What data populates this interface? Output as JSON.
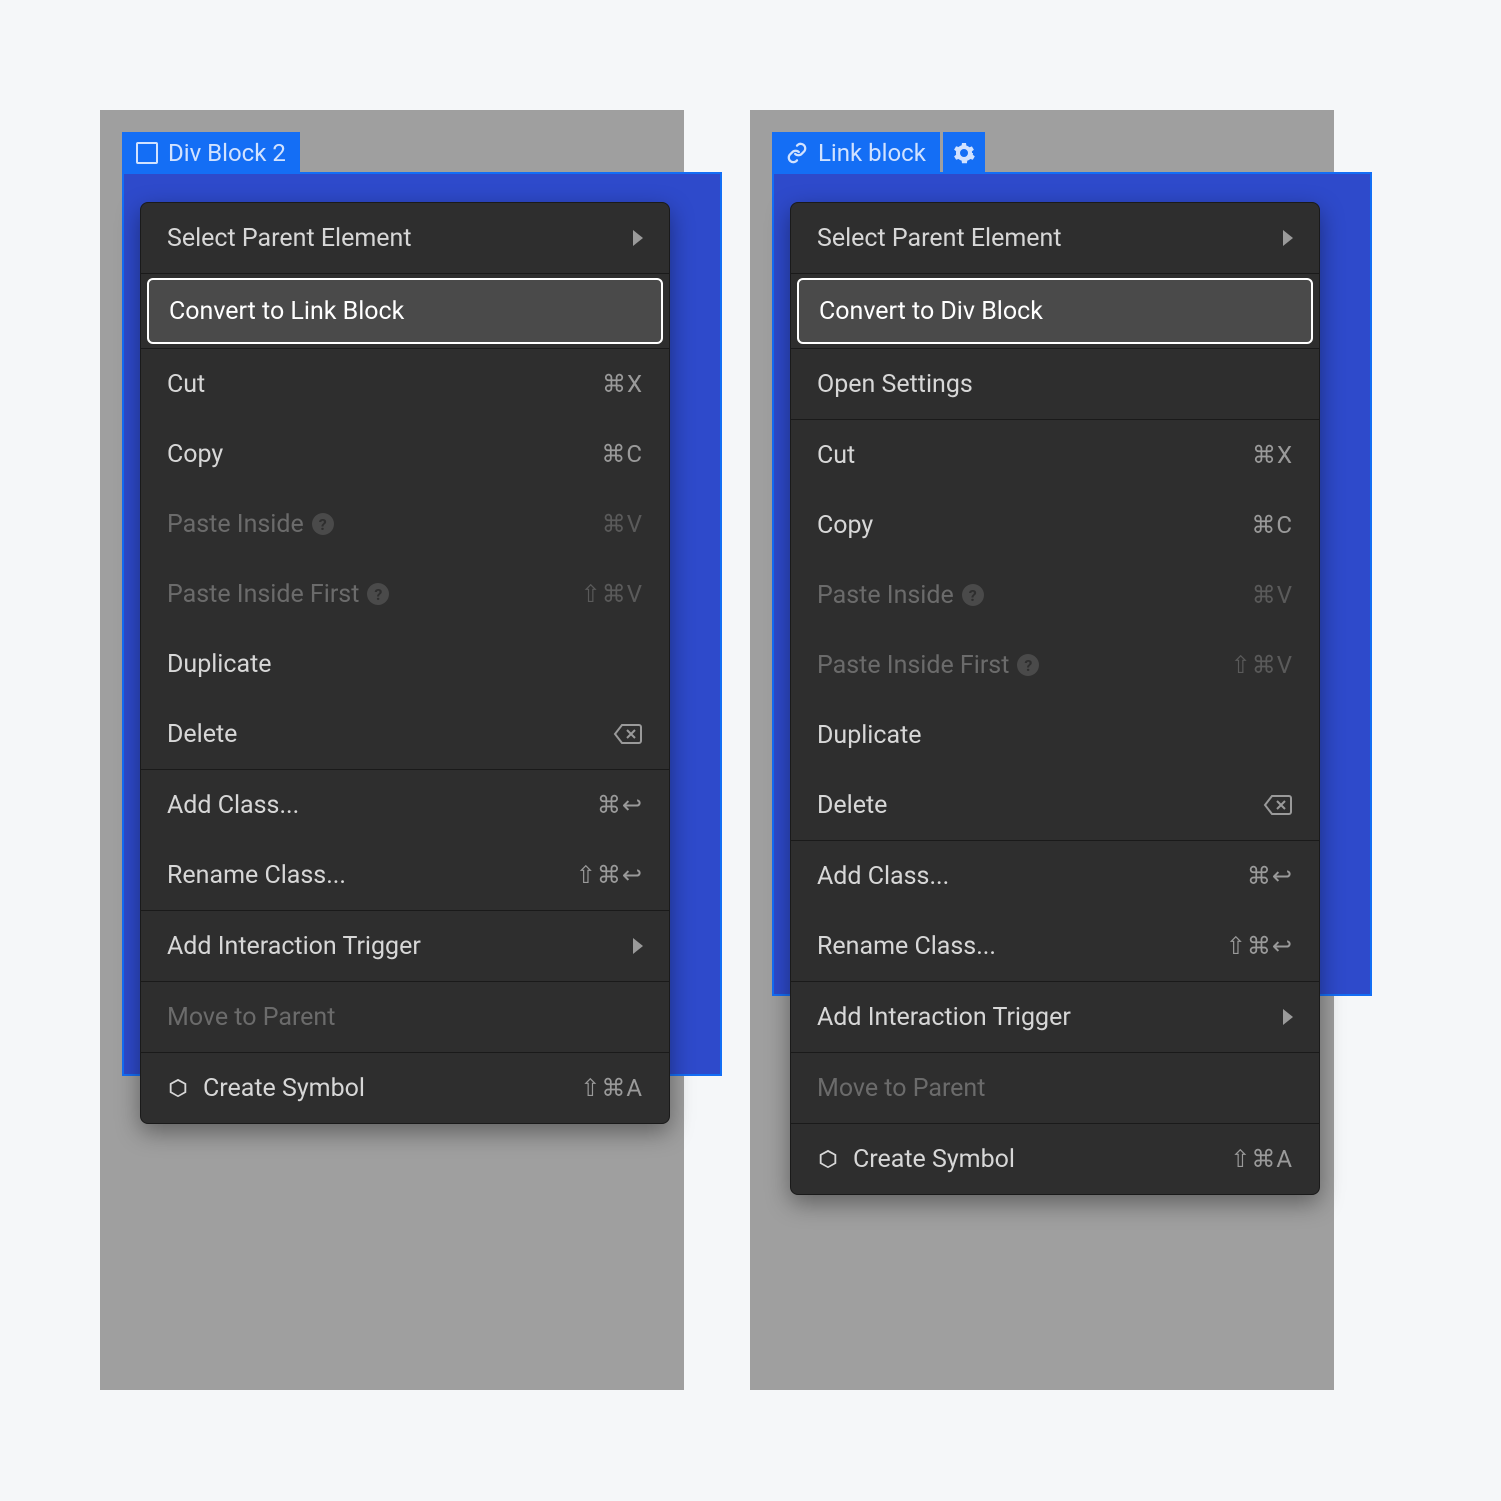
{
  "panels": [
    {
      "badge": {
        "icon": "box",
        "label": "Div Block 2"
      },
      "gear": false,
      "menu": {
        "groups": [
          [
            {
              "id": "select-parent",
              "label": "Select Parent Element",
              "submenu": true
            }
          ],
          [
            {
              "id": "convert-link",
              "label": "Convert to Link Block",
              "highlight": true
            }
          ],
          [
            {
              "id": "cut",
              "label": "Cut",
              "shortcut": "⌘X"
            },
            {
              "id": "copy",
              "label": "Copy",
              "shortcut": "⌘C"
            },
            {
              "id": "paste-inside",
              "label": "Paste Inside",
              "shortcut": "⌘V",
              "disabled": true,
              "help": true
            },
            {
              "id": "paste-inside-first",
              "label": "Paste Inside First",
              "shortcut": "⇧⌘V",
              "disabled": true,
              "help": true
            },
            {
              "id": "duplicate",
              "label": "Duplicate"
            },
            {
              "id": "delete",
              "label": "Delete",
              "shortcutIcon": "backspace"
            }
          ],
          [
            {
              "id": "add-class",
              "label": "Add Class...",
              "shortcut": "⌘↩"
            },
            {
              "id": "rename-class",
              "label": "Rename Class...",
              "shortcut": "⇧⌘↩"
            }
          ],
          [
            {
              "id": "add-interaction",
              "label": "Add Interaction Trigger",
              "submenu": true
            }
          ],
          [
            {
              "id": "move-parent",
              "label": "Move to Parent",
              "disabled": true
            }
          ],
          [
            {
              "id": "create-symbol",
              "label": "Create Symbol",
              "shortcut": "⇧⌘A",
              "icon": "cube"
            }
          ]
        ]
      }
    },
    {
      "badge": {
        "icon": "link",
        "label": "Link block"
      },
      "gear": true,
      "menu": {
        "groups": [
          [
            {
              "id": "select-parent",
              "label": "Select Parent Element",
              "submenu": true
            }
          ],
          [
            {
              "id": "convert-div",
              "label": "Convert to Div Block",
              "highlight": true
            }
          ],
          [
            {
              "id": "open-settings",
              "label": "Open Settings"
            }
          ],
          [
            {
              "id": "cut",
              "label": "Cut",
              "shortcut": "⌘X"
            },
            {
              "id": "copy",
              "label": "Copy",
              "shortcut": "⌘C"
            },
            {
              "id": "paste-inside",
              "label": "Paste Inside",
              "shortcut": "⌘V",
              "disabled": true,
              "help": true
            },
            {
              "id": "paste-inside-first",
              "label": "Paste Inside First",
              "shortcut": "⇧⌘V",
              "disabled": true,
              "help": true
            },
            {
              "id": "duplicate",
              "label": "Duplicate"
            },
            {
              "id": "delete",
              "label": "Delete",
              "shortcutIcon": "backspace"
            }
          ],
          [
            {
              "id": "add-class",
              "label": "Add Class...",
              "shortcut": "⌘↩"
            },
            {
              "id": "rename-class",
              "label": "Rename Class...",
              "shortcut": "⇧⌘↩"
            }
          ],
          [
            {
              "id": "add-interaction",
              "label": "Add Interaction Trigger",
              "submenu": true
            }
          ],
          [
            {
              "id": "move-parent",
              "label": "Move to Parent",
              "disabled": true
            }
          ],
          [
            {
              "id": "create-symbol",
              "label": "Create Symbol",
              "shortcut": "⇧⌘A",
              "icon": "cube"
            }
          ]
        ]
      }
    }
  ]
}
